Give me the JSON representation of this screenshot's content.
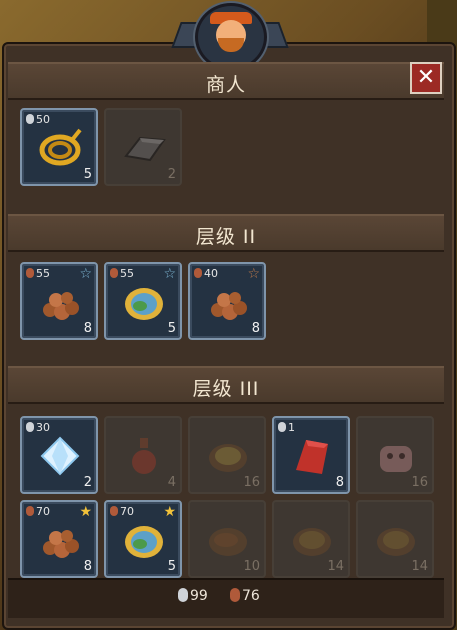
{
  "merchant": {
    "title": "商人",
    "close_label": "✕"
  },
  "tier2": {
    "title": "层级 II"
  },
  "tier3": {
    "title": "层级 III"
  },
  "merchant_slots": [
    {
      "price": "50",
      "qty": "5",
      "icon": "rope-icon"
    },
    {
      "price": "",
      "qty": "2",
      "icon": "iron-ingot-icon"
    }
  ],
  "tier2_slots": [
    {
      "price": "55",
      "qty": "8",
      "icon": "ore-pile-icon",
      "star": "☆"
    },
    {
      "price": "55",
      "qty": "5",
      "icon": "orb-icon",
      "star": "☆"
    },
    {
      "price": "40",
      "qty": "8",
      "icon": "ore-pile-icon",
      "star": "☆"
    }
  ],
  "tier3_row1": [
    {
      "price": "30",
      "qty": "2",
      "icon": "diamond-icon"
    },
    {
      "price": "",
      "qty": "4",
      "icon": "bottle-icon"
    },
    {
      "price": "",
      "qty": "16",
      "icon": "bowl-icon"
    },
    {
      "price": "1",
      "qty": "8",
      "icon": "red-cloth-icon"
    },
    {
      "price": "",
      "qty": "16",
      "icon": "cow-icon"
    }
  ],
  "tier3_row2": [
    {
      "price": "70",
      "qty": "8",
      "icon": "ore-pile-icon",
      "star": "★"
    },
    {
      "price": "70",
      "qty": "5",
      "icon": "orb-icon",
      "star": "★"
    },
    {
      "price": "",
      "qty": "10",
      "icon": "grilled-fish-icon"
    },
    {
      "price": "",
      "qty": "14",
      "icon": "bowl-icon"
    },
    {
      "price": "",
      "qty": "14",
      "icon": "bowl-icon"
    }
  ],
  "currency": {
    "silver": "99",
    "copper": "76"
  },
  "colors": {
    "active_slot_border": "#7f95ab",
    "header_text": "#f2e6d0",
    "close_bg": "#9c2a24",
    "gold_star": "#f2c23a",
    "blue_star": "#7fb8d6",
    "bronze_star": "#c07a4a"
  }
}
